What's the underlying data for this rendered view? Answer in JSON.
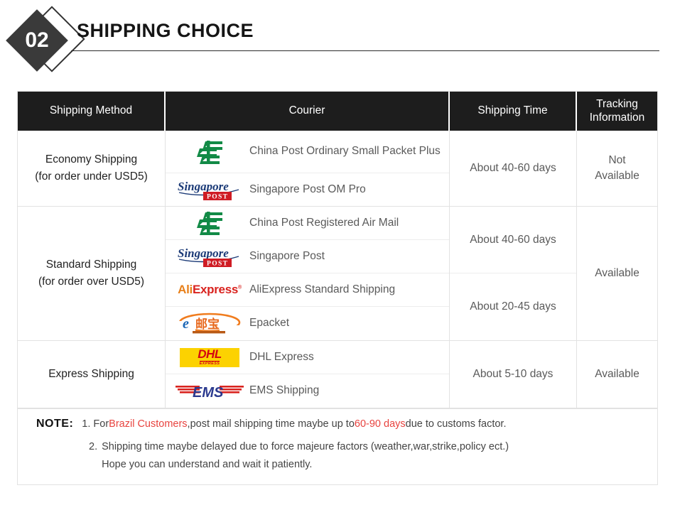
{
  "header": {
    "badge_number": "02",
    "title": "SHIPPING CHOICE"
  },
  "table": {
    "columns": [
      {
        "key": "method",
        "label": "Shipping Method"
      },
      {
        "key": "courier",
        "label": "Courier"
      },
      {
        "key": "time",
        "label": "Shipping Time"
      },
      {
        "key": "track",
        "label": "Tracking\nInformation"
      }
    ],
    "column_labels": {
      "method": "Shipping Method",
      "courier": "Courier",
      "time": "Shipping Time",
      "track_line1": "Tracking",
      "track_line2": "Information"
    },
    "groups": [
      {
        "method_line1": "Economy Shipping",
        "method_line2": "(for order under USD5)",
        "couriers": [
          {
            "logo": "china-post-logo",
            "name": "China Post Ordinary Small Packet Plus"
          },
          {
            "logo": "singapore-post-logo",
            "name": "Singapore Post OM Pro"
          }
        ],
        "times": [
          "About 40-60 days"
        ],
        "tracking": [
          "Not Available"
        ]
      },
      {
        "method_line1": "Standard Shipping",
        "method_line2": "(for order over USD5)",
        "couriers": [
          {
            "logo": "china-post-logo",
            "name": "China Post Registered Air Mail"
          },
          {
            "logo": "singapore-post-logo",
            "name": "Singapore Post"
          },
          {
            "logo": "aliexpress-logo",
            "name": "AliExpress Standard Shipping"
          },
          {
            "logo": "epacket-logo",
            "name": "Epacket"
          }
        ],
        "times": [
          "About 40-60 days",
          "About 20-45 days"
        ],
        "tracking": [
          "Available"
        ]
      },
      {
        "method_line1": "Express Shipping",
        "method_line2": "",
        "couriers": [
          {
            "logo": "dhl-logo",
            "name": "DHL Express"
          },
          {
            "logo": "ems-logo",
            "name": "EMS Shipping"
          }
        ],
        "times": [
          "About 5-10 days"
        ],
        "tracking": [
          "Available"
        ]
      }
    ]
  },
  "note": {
    "label": "NOTE:",
    "item1_num": "1.",
    "item1_part1": "For ",
    "item1_red1": "Brazil Customers",
    "item1_part2": ",post mail shipping time maybe up to ",
    "item1_red2": "60-90 days",
    "item1_part3": " due to customs factor.",
    "item2_num": "2.",
    "item2_line1": "Shipping time maybe delayed due to force majeure factors (weather,war,strike,policy ect.)",
    "item2_line2": "Hope you can understand and wait it patiently."
  },
  "logos": {
    "china_post": {
      "name": "China Post",
      "color": "#128a46"
    },
    "singapore_post": {
      "name": "Singapore Post",
      "script_color": "#1b3a77",
      "box_color": "#cf1c24",
      "box_text": "POST"
    },
    "aliexpress": {
      "name": "AliExpress",
      "ali_text": "Ali",
      "express_text": "Express",
      "ali_color": "#e8801a",
      "express_color": "#d9231f"
    },
    "epacket": {
      "name": "Epacket",
      "e_color": "#1b66b5",
      "swoosh_color": "#f07c1e",
      "cn_text": "邮宝",
      "cn_color": "#e8681c"
    },
    "dhl": {
      "name": "DHL Express",
      "text": "DHL",
      "sub_text": "EXPRESS",
      "bg_color": "#fcd201",
      "fg_color": "#d40511"
    },
    "ems": {
      "name": "EMS",
      "text": "EMS",
      "text_color": "#2b3a8f",
      "stripe_color": "#d9231f"
    }
  }
}
